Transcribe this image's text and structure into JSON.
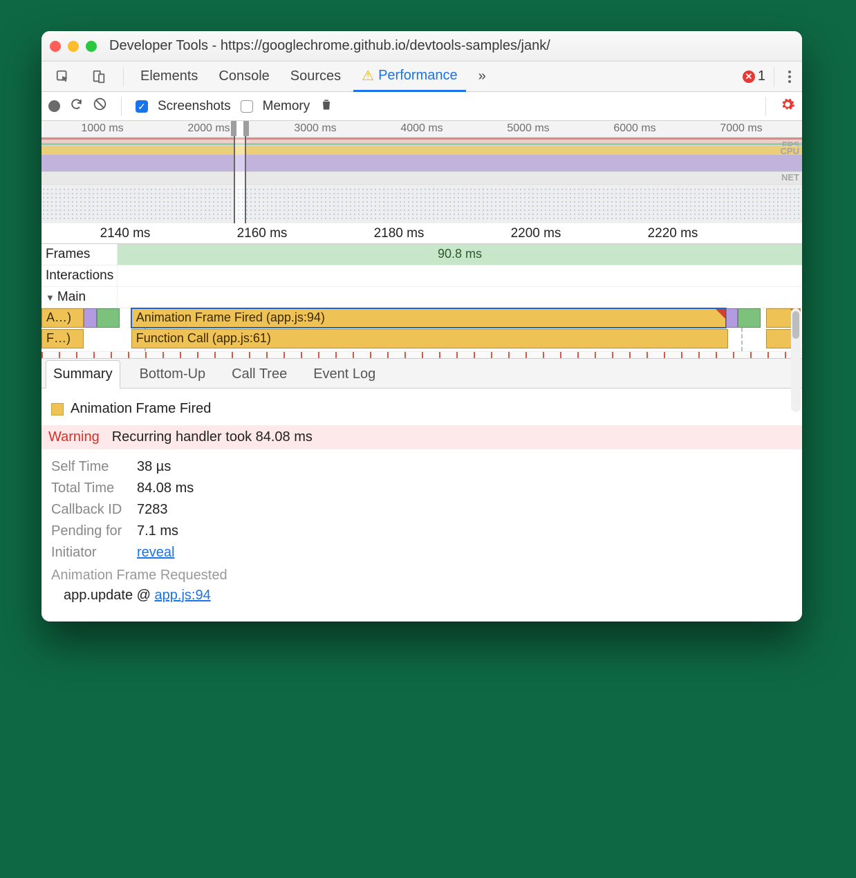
{
  "window": {
    "title": "Developer Tools - https://googlechrome.github.io/devtools-samples/jank/"
  },
  "tabs": {
    "elements": "Elements",
    "console": "Console",
    "sources": "Sources",
    "performance": "Performance",
    "overflow": "»",
    "error_count": "1"
  },
  "toolbar": {
    "screenshots_label": "Screenshots",
    "memory_label": "Memory"
  },
  "overview": {
    "ticks": [
      "1000 ms",
      "2000 ms",
      "3000 ms",
      "4000 ms",
      "5000 ms",
      "6000 ms",
      "7000 ms"
    ],
    "fps_label": "FPS",
    "cpu_label": "CPU",
    "net_label": "NET"
  },
  "flame": {
    "ticks": [
      "2140 ms",
      "2160 ms",
      "2180 ms",
      "2200 ms",
      "2220 ms"
    ],
    "frames_label": "Frames",
    "frames_value": "90.8 ms",
    "interactions_label": "Interactions",
    "main_label": "Main",
    "bar_a": "A…)",
    "bar_anim": "Animation Frame Fired (app.js:94)",
    "bar_f": "F…)",
    "bar_func": "Function Call (app.js:61)"
  },
  "dtabs": {
    "summary": "Summary",
    "bottomup": "Bottom-Up",
    "calltree": "Call Tree",
    "eventlog": "Event Log"
  },
  "summary": {
    "event_title": "Animation Frame Fired",
    "warning_label": "Warning",
    "warning_text": "Recurring handler took 84.08 ms",
    "selftime_k": "Self Time",
    "selftime_v": "38 µs",
    "totaltime_k": "Total Time",
    "totaltime_v": "84.08 ms",
    "callback_k": "Callback ID",
    "callback_v": "7283",
    "pending_k": "Pending for",
    "pending_v": "7.1 ms",
    "initiator_k": "Initiator",
    "initiator_link": "reveal",
    "requested": "Animation Frame Requested",
    "stack_fn": "app.update @ ",
    "stack_link": "app.js:94"
  }
}
